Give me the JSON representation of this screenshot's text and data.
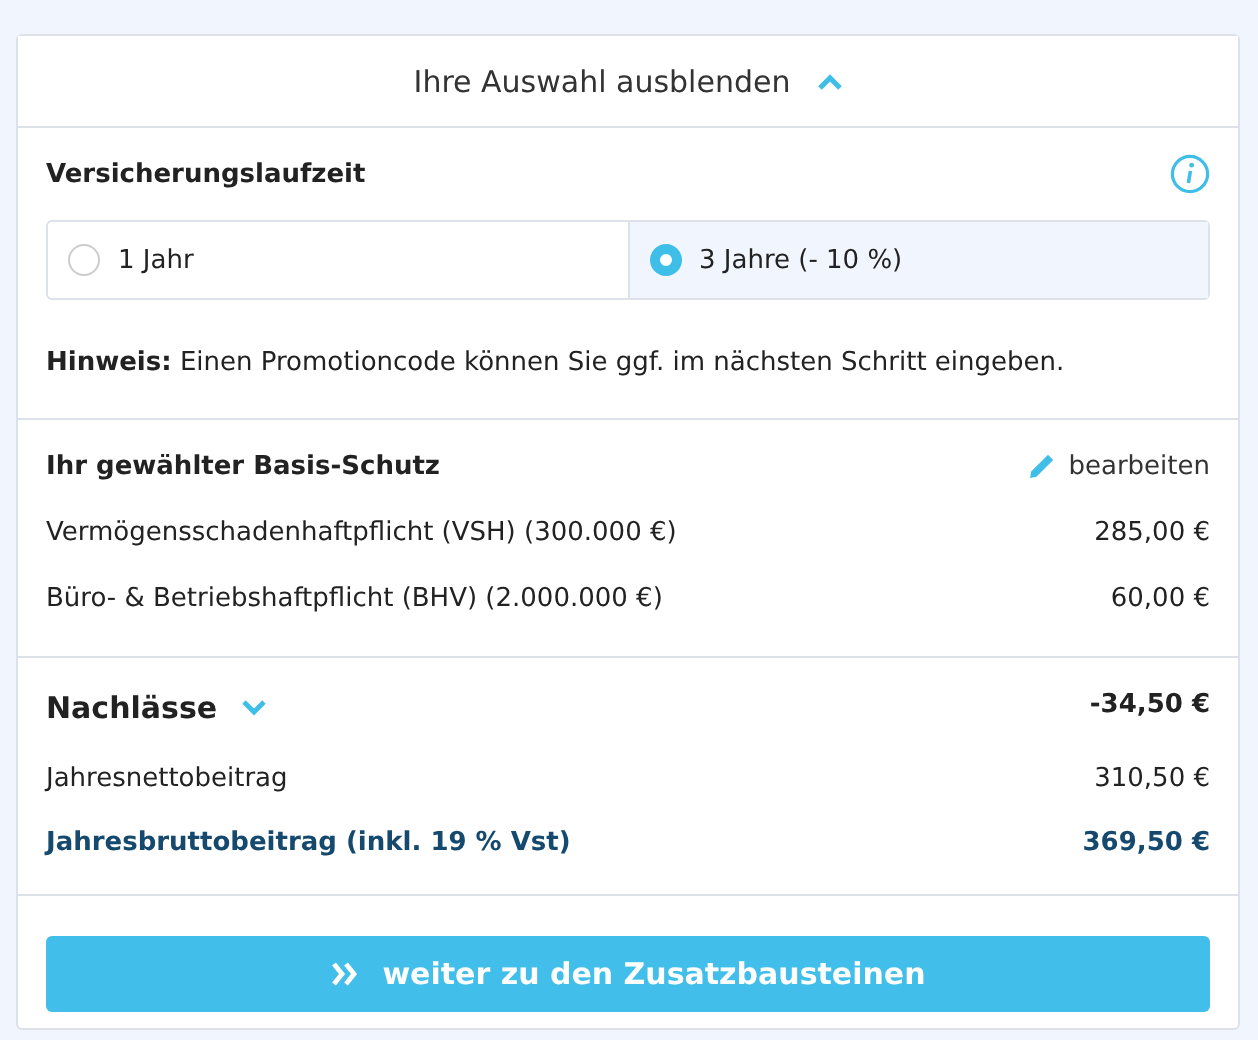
{
  "toggle": {
    "label": "Ihre Auswahl ausblenden",
    "expanded": true
  },
  "term": {
    "title": "Versicherungslaufzeit",
    "options": [
      {
        "label": "1 Jahr",
        "selected": false
      },
      {
        "label": "3 Jahre (- 10 %)",
        "selected": true
      }
    ],
    "hint": "**Hinweis:** Einen Promotioncode können Sie ggf. im nächsten Schritt eingeben."
  },
  "basis": {
    "title": "Ihr gewählter Basis-Schutz",
    "edit_label": "bearbeiten",
    "items": [
      {
        "label": "Vermögensschadenhaftpflicht (VSH) (300.000 €)",
        "amount": "285,00 €"
      },
      {
        "label": "Büro- & Betriebshaftpflicht (BHV) (2.000.000 €)",
        "amount": "60,00 €"
      }
    ]
  },
  "summary": [
    {
      "kind": "discount",
      "label": "Nachlässe",
      "amount": "-34,50 €",
      "expanded": false
    },
    {
      "kind": "net",
      "label": "Jahresnettobeitrag",
      "amount": "310,50 €"
    },
    {
      "kind": "gross",
      "label": "Jahresbruttobeitrag (inkl. 19 % Vst)",
      "amount": "369,50 €"
    }
  ],
  "continue_button": "weiter zu den Zusatzbausteinen"
}
